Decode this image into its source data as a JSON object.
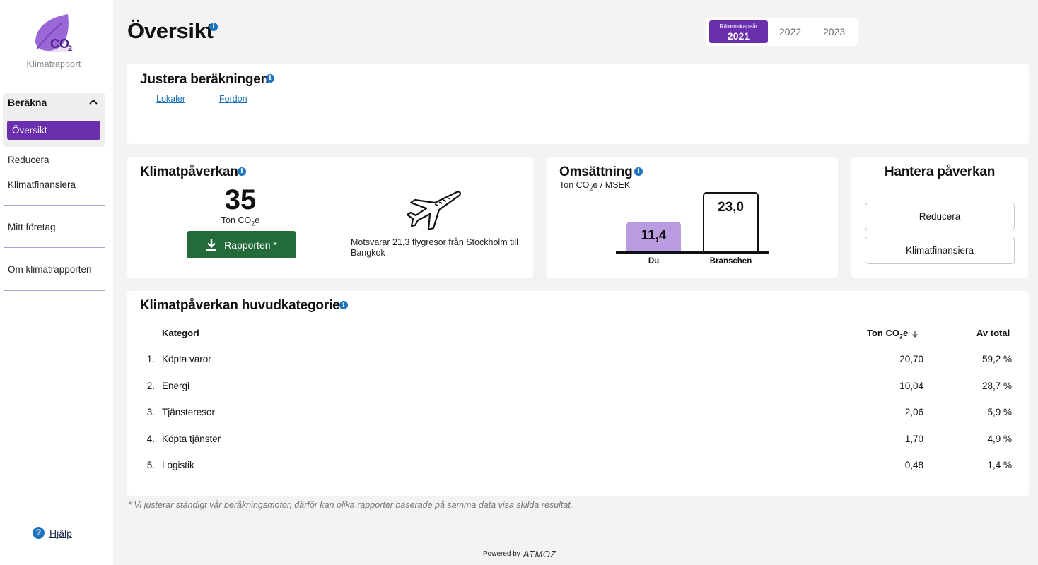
{
  "sidebar": {
    "logo_text": "CO2",
    "caption": "Klimatrapport",
    "group_header": "Beräkna",
    "active_item": "Översikt",
    "items": [
      "Reducera",
      "Klimatfinansiera",
      "Mitt företag",
      "Om klimatrapporten"
    ],
    "help": "Hjälp"
  },
  "header": {
    "title": "Översikt",
    "year_label": "Räkenskapsår",
    "years": [
      "2021",
      "2022",
      "2023"
    ],
    "selected_year": "2021"
  },
  "adjust": {
    "title": "Justera beräkningen",
    "links": [
      "Lokaler",
      "Fordon"
    ]
  },
  "impact": {
    "title": "Klimatpåverkan",
    "value": "35",
    "unit_pre": "Ton CO",
    "unit_sub": "2",
    "unit_post": "e",
    "button": "Rapporten *",
    "flight_text": "Motsvarar 21,3 flygresor från Stockholm till Bangkok"
  },
  "turnover": {
    "title": "Omsättning",
    "unit_pre": "Ton CO",
    "unit_sub": "2",
    "unit_post": "e / MSEK"
  },
  "chart_data": {
    "type": "bar",
    "categories": [
      "Du",
      "Branschen"
    ],
    "values": [
      11.4,
      23.0
    ],
    "value_labels": [
      "11,4",
      "23,0"
    ],
    "ylabel": "Ton CO2e / MSEK",
    "colors": [
      "#b99ce0",
      "#ffffff"
    ]
  },
  "manage": {
    "title": "Hantera påverkan",
    "buttons": [
      "Reducera",
      "Klimatfinansiera"
    ]
  },
  "categories": {
    "title": "Klimatpåverkan huvudkategorier",
    "headers": {
      "category": "Kategori",
      "ton_pre": "Ton CO",
      "ton_sub": "2",
      "ton_post": "e",
      "share": "Av total"
    },
    "rows": [
      {
        "rank": "1.",
        "name": "Köpta varor",
        "ton": "20,70",
        "share": "59,2 %"
      },
      {
        "rank": "2.",
        "name": "Energi",
        "ton": "10,04",
        "share": "28,7 %"
      },
      {
        "rank": "3.",
        "name": "Tjänsteresor",
        "ton": "2,06",
        "share": "5,9 %"
      },
      {
        "rank": "4.",
        "name": "Köpta tjänster",
        "ton": "1,70",
        "share": "4,9 %"
      },
      {
        "rank": "5.",
        "name": "Logistik",
        "ton": "0,48",
        "share": "1,4 %"
      }
    ]
  },
  "footnote": "* Vi justerar ständigt vår beräkningsmotor, därför kan olika rapporter baserade på samma data visa skilda resultat.",
  "footer": {
    "powered_by": "Powered by",
    "brand": "ATMOZ"
  },
  "colors": {
    "accent": "#6b2fae",
    "button_green": "#246b3c",
    "info_blue": "#1e73be"
  }
}
